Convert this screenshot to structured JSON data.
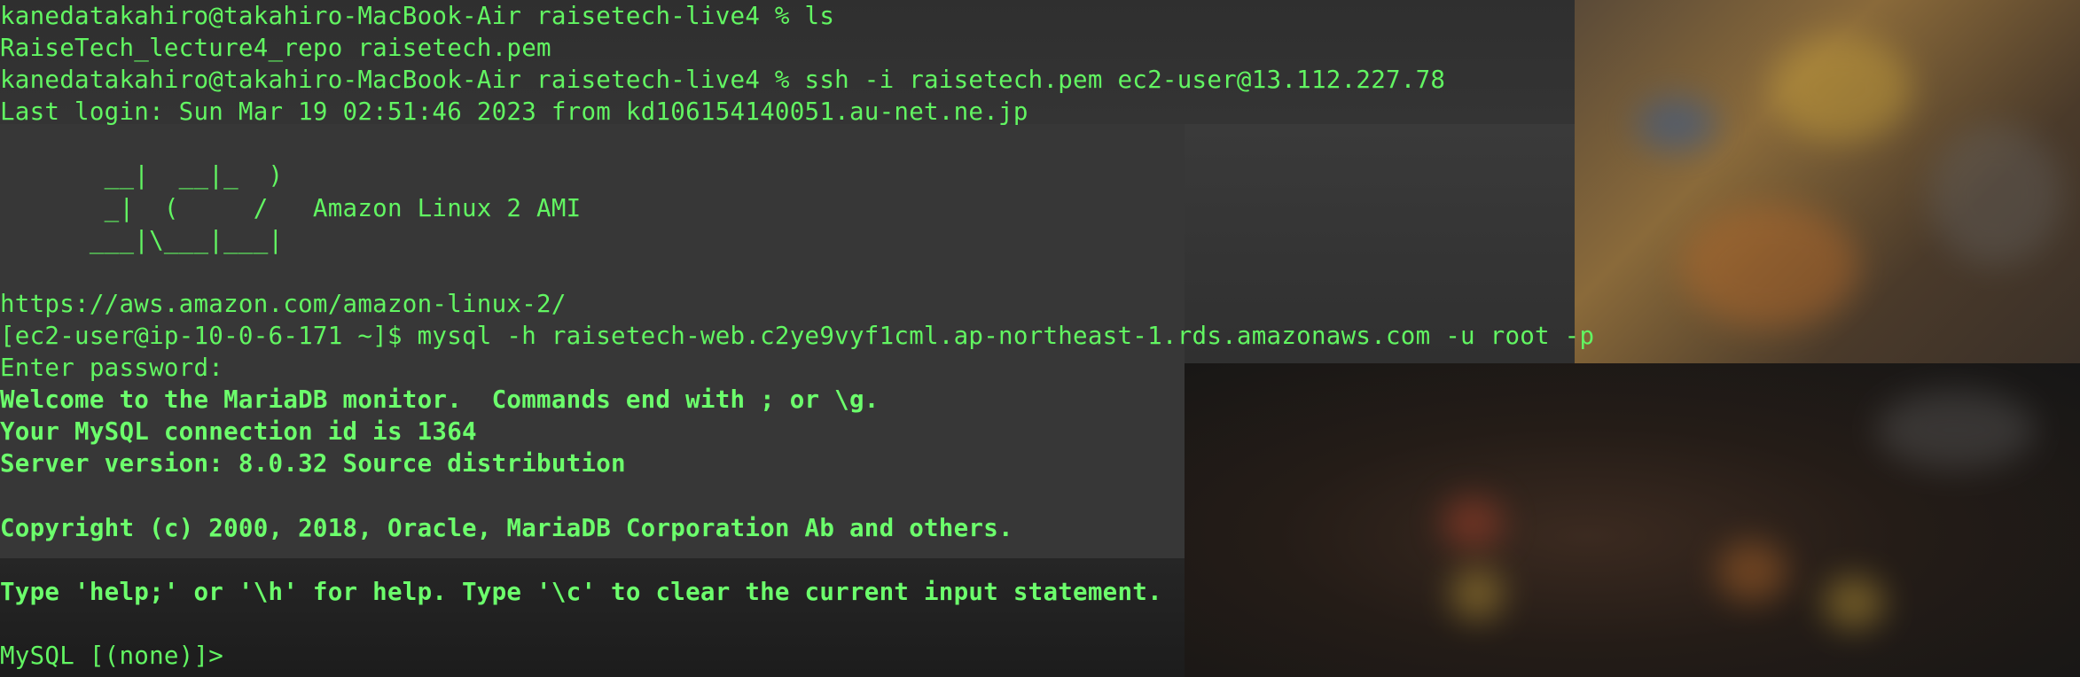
{
  "terminal": {
    "lines": [
      {
        "text": "kanedatakahiro@takahiro-MacBook-Air raisetech-live4 % ls",
        "bold": false
      },
      {
        "text": "RaiseTech_lecture4_repo raisetech.pem",
        "bold": false
      },
      {
        "text": "kanedatakahiro@takahiro-MacBook-Air raisetech-live4 % ssh -i raisetech.pem ec2-user@13.112.227.78",
        "bold": false
      },
      {
        "text": "Last login: Sun Mar 19 02:51:46 2023 from kd106154140051.au-net.ne.jp",
        "bold": false
      },
      {
        "text": "",
        "bold": false
      },
      {
        "text": "       __|  __|_  )",
        "bold": false
      },
      {
        "text": "       _|  (     /   Amazon Linux 2 AMI",
        "bold": false
      },
      {
        "text": "      ___|\\___|___|",
        "bold": false
      },
      {
        "text": "",
        "bold": false
      },
      {
        "text": "https://aws.amazon.com/amazon-linux-2/",
        "bold": false
      },
      {
        "text": "[ec2-user@ip-10-0-6-171 ~]$ mysql -h raisetech-web.c2ye9vyf1cml.ap-northeast-1.rds.amazonaws.com -u root -p",
        "bold": false
      },
      {
        "text": "Enter password:",
        "bold": false
      },
      {
        "text": "Welcome to the MariaDB monitor.  Commands end with ; or \\g.",
        "bold": true
      },
      {
        "text": "Your MySQL connection id is 1364",
        "bold": true
      },
      {
        "text": "Server version: 8.0.32 Source distribution",
        "bold": true
      },
      {
        "text": "",
        "bold": false
      },
      {
        "text": "Copyright (c) 2000, 2018, Oracle, MariaDB Corporation Ab and others.",
        "bold": true
      },
      {
        "text": "",
        "bold": false
      },
      {
        "text": "Type 'help;' or '\\h' for help. Type '\\c' to clear the current input statement.",
        "bold": true
      },
      {
        "text": "",
        "bold": false
      },
      {
        "text": "MySQL [(none)]>",
        "bold": false
      }
    ],
    "text_color": "#62f562",
    "background_color": "#2a2a2a"
  }
}
